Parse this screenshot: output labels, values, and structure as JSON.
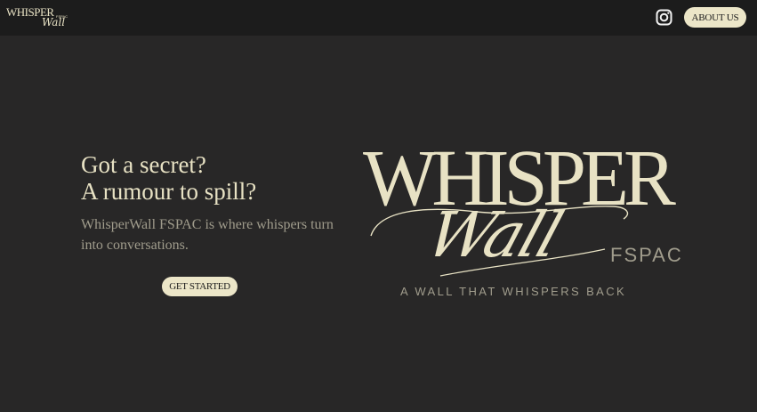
{
  "header": {
    "logo": {
      "line1": "WHISPER",
      "line2": "Wall",
      "line3": "FSPAC"
    },
    "instagram_icon": "instagram-icon",
    "about_label": "ABOUT US"
  },
  "hero": {
    "headline_line1": "Got a secret?",
    "headline_line2": "A rumour to spill?",
    "description": "WhisperWall FSPAC is where whispers turn into conversations.",
    "cta_label": "GET STARTED"
  },
  "brand": {
    "title": "WHISPER",
    "script": "Wall",
    "suffix": "FSPAC",
    "tagline": "A WALL THAT WHISPERS BACK"
  },
  "colors": {
    "background": "#282727",
    "header": "#1c1c1c",
    "accent": "#ece6c8",
    "muted_text": "#a09c8c"
  }
}
